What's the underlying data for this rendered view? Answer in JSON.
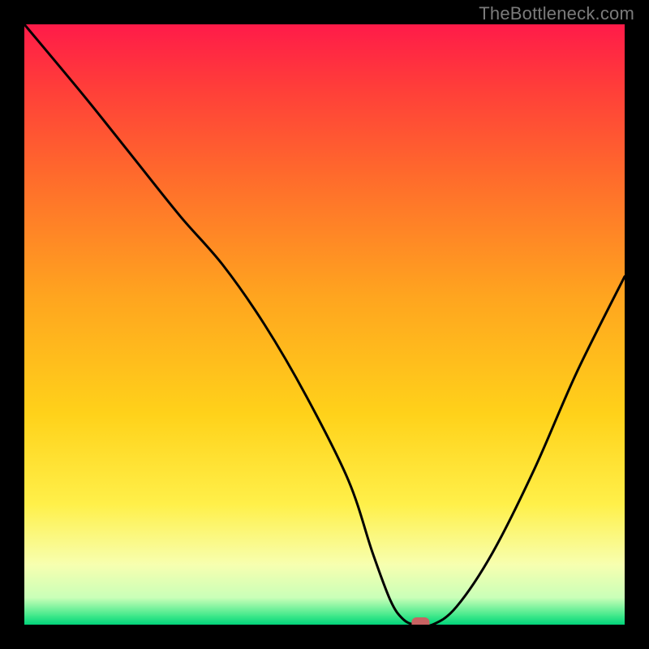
{
  "watermark": "TheBottleneck.com",
  "chart_data": {
    "type": "line",
    "title": "",
    "xlabel": "",
    "ylabel": "",
    "xlim": [
      0,
      100
    ],
    "ylim": [
      0,
      100
    ],
    "x": [
      0,
      10,
      18,
      26,
      33,
      40,
      47,
      54,
      58,
      61,
      63,
      65,
      68,
      72,
      78,
      85,
      92,
      100
    ],
    "values": [
      100,
      88,
      78,
      68,
      60,
      50,
      38,
      24,
      12,
      4,
      1,
      0,
      0,
      3,
      12,
      26,
      42,
      58
    ],
    "marker": {
      "x": 66,
      "y": 0,
      "color": "#c86262"
    },
    "gradient_bands": [
      {
        "y0": 0.0,
        "y1": 0.1,
        "from": "#ff1b49",
        "to": "#ff3c3a"
      },
      {
        "y0": 0.1,
        "y1": 0.25,
        "from": "#ff3c3a",
        "to": "#ff6a2c"
      },
      {
        "y0": 0.25,
        "y1": 0.45,
        "from": "#ff6a2c",
        "to": "#ffa41f"
      },
      {
        "y0": 0.45,
        "y1": 0.65,
        "from": "#ffa41f",
        "to": "#ffd21a"
      },
      {
        "y0": 0.65,
        "y1": 0.8,
        "from": "#ffd21a",
        "to": "#fff04a"
      },
      {
        "y0": 0.8,
        "y1": 0.9,
        "from": "#fff04a",
        "to": "#f7ffb0"
      },
      {
        "y0": 0.9,
        "y1": 0.955,
        "from": "#f7ffb0",
        "to": "#c9ffb8"
      },
      {
        "y0": 0.955,
        "y1": 0.985,
        "from": "#c9ffb8",
        "to": "#3fe88a"
      },
      {
        "y0": 0.985,
        "y1": 1.0,
        "from": "#3fe88a",
        "to": "#00d37a"
      }
    ]
  }
}
